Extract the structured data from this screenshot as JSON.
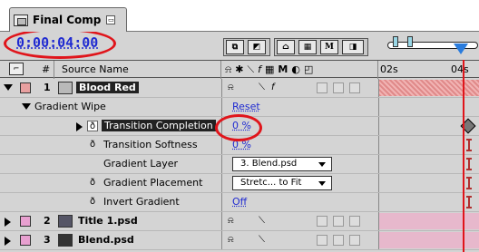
{
  "tab": {
    "title": "Final Comp"
  },
  "timecode": "0:00:04:00",
  "ruler": {
    "start": "02s",
    "end": "04s"
  },
  "columns": {
    "source_name": "Source Name",
    "number": "#"
  },
  "switch_icons": [
    "layer-switch-icon",
    "asterisk-icon",
    "quality-icon",
    "effect-f-icon",
    "frame-blend-icon",
    "motion-blur-icon",
    "adjustment-layer-icon",
    "3d-layer-icon"
  ],
  "layers": [
    {
      "num": "1",
      "name": "Blood Red",
      "color": "#e8a0a0",
      "expanded": true
    },
    {
      "num": "2",
      "name": "Title 1.psd",
      "color": "#e8a0d0",
      "expanded": false
    },
    {
      "num": "3",
      "name": "Blend.psd",
      "color": "#e8a0d0",
      "expanded": false
    }
  ],
  "effect": {
    "name": "Gradient Wipe",
    "reset": "Reset"
  },
  "props": [
    {
      "name": "Transition Completion",
      "value": "0 %",
      "selected": true
    },
    {
      "name": "Transition Softness",
      "value": "0 %"
    },
    {
      "name": "Gradient Layer",
      "value": "3. Blend.psd"
    },
    {
      "name": "Gradient Placement",
      "value": "Stretc... to Fit"
    },
    {
      "name": "Invert Gradient",
      "value": "Off"
    }
  ],
  "colors": {
    "timecode": "#1f2ad1",
    "highlight": "#e0151b",
    "dither_a": "#e08a8a",
    "dither_b": "#f1b3b3",
    "bar": "#e7b8cc"
  }
}
